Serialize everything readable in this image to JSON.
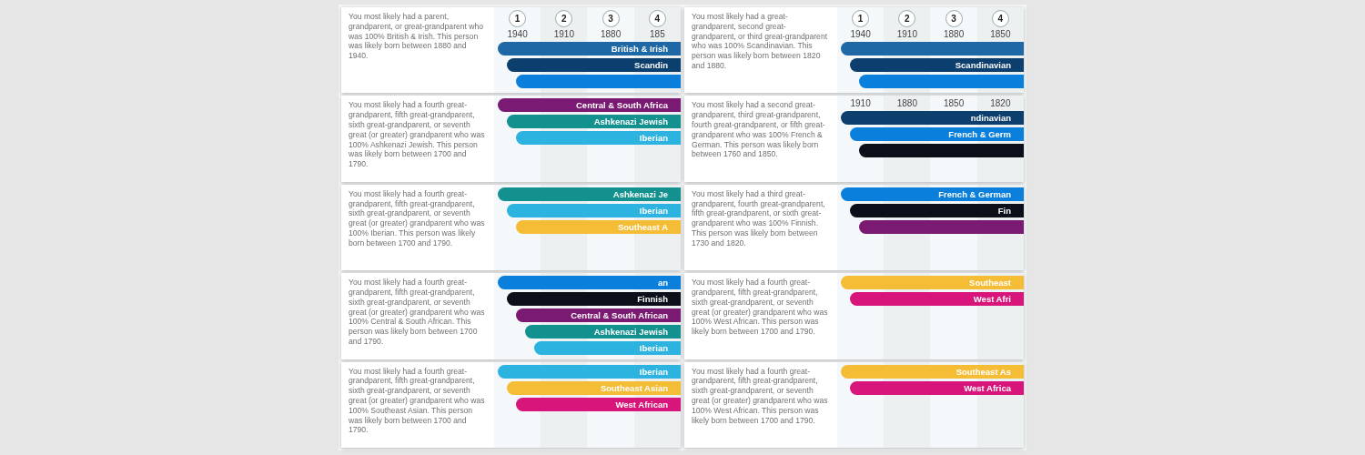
{
  "columns": [
    {
      "cards": [
        {
          "description": "You most likely had a parent, grandparent, or great-grandparent who was 100% British & Irish. This person was likely born between 1880 and 1940.",
          "steps": [
            {
              "number": "1",
              "year": "1940"
            },
            {
              "number": "2",
              "year": "1910"
            },
            {
              "number": "3",
              "year": "1880"
            },
            {
              "number": "4",
              "year": "185"
            }
          ],
          "bars": [
            {
              "label": "British & Irish",
              "color": "#1f68a6"
            },
            {
              "label": "Scandin",
              "color": "#0d3f6e"
            },
            {
              "color": "#0b7fdc"
            }
          ]
        },
        {
          "description": "You most likely had a fourth great-grandparent, fifth great-grandparent, sixth great-grandparent, or seventh great (or greater) grandparent who was 100% Ashkenazi Jewish. This person was likely born between 1700 and 1790.",
          "bars": [
            {
              "label": "Central & South Africa",
              "color": "#7a1a72"
            },
            {
              "label": "Ashkenazi Jewish",
              "color": "#12918f"
            },
            {
              "label": "Iberian",
              "color": "#2cb3e0"
            }
          ]
        },
        {
          "description": "You most likely had a fourth great-grandparent, fifth great-grandparent, sixth great-grandparent, or seventh great (or greater) grandparent who was 100% Iberian. This person was likely born between 1700 and 1790.",
          "bars": [
            {
              "label": "Ashkenazi Je",
              "color": "#12918f"
            },
            {
              "label": "Iberian",
              "color": "#2cb3e0"
            },
            {
              "label": "Southeast A",
              "color": "#f5bd35"
            }
          ]
        },
        {
          "description": "You most likely had a fourth great-grandparent, fifth great-grandparent, sixth great-grandparent, or seventh great (or greater) grandparent who was 100% Central & South African. This person was likely born between 1700 and 1790.",
          "bars": [
            {
              "label": "an",
              "color": "#0b7fdc"
            },
            {
              "label": "Finnish",
              "color": "#0a0f1a"
            },
            {
              "label": "Central & South African",
              "color": "#7a1a72"
            },
            {
              "label": "Ashkenazi Jewish",
              "color": "#12918f"
            },
            {
              "label": "Iberian",
              "color": "#2cb3e0"
            }
          ]
        },
        {
          "description": "You most likely had a fourth great-grandparent, fifth great-grandparent, sixth great-grandparent, or seventh great (or greater) grandparent who was 100% Southeast Asian. This person was likely born between 1700 and 1790.",
          "bars": [
            {
              "label": "Iberian",
              "color": "#2cb3e0"
            },
            {
              "label": "Southeast Asian",
              "color": "#f5bd35"
            },
            {
              "label": "West African",
              "color": "#d8157a"
            }
          ]
        }
      ]
    },
    {
      "cards": [
        {
          "description": "You most likely had a great-grandparent, second great-grandparent, or third great-grandparent who was 100% Scandinavian. This person was likely born between 1820 and 1880.",
          "steps": [
            {
              "number": "1",
              "year": "1940"
            },
            {
              "number": "2",
              "year": "1910"
            },
            {
              "number": "3",
              "year": "1880"
            },
            {
              "number": "4",
              "year": "1850"
            }
          ],
          "bars": [
            {
              "color": "#1f68a6"
            },
            {
              "label": "Scandinavian",
              "color": "#0d3f6e"
            },
            {
              "color": "#0b7fdc"
            }
          ]
        },
        {
          "description": "You most likely had a second great-grandparent, third great-grandparent, fourth great-grandparent, or fifth great-grandparent who was 100% French & German. This person was likely born between 1760 and 1850.",
          "years": [
            "1910",
            "1880",
            "1850",
            "1820"
          ],
          "bars": [
            {
              "label": "ndinavian",
              "color": "#0d3f6e"
            },
            {
              "label": "French & Germ",
              "color": "#0b7fdc"
            },
            {
              "color": "#0a0f1a"
            }
          ]
        },
        {
          "description": "You most likely had a third great-grandparent, fourth great-grandparent, fifth great-grandparent, or sixth great-grandparent who was 100% Finnish. This person was likely born between 1730 and 1820.",
          "bars": [
            {
              "label": "French & German",
              "color": "#0b7fdc"
            },
            {
              "label": "Fin",
              "color": "#0a0f1a"
            },
            {
              "color": "#7a1a72"
            }
          ]
        },
        {
          "description": "You most likely had a fourth great-grandparent, fifth great-grandparent, sixth great-grandparent, or seventh great (or greater) grandparent who was 100% West African. This person was likely born between 1700 and 1790.",
          "bars": [
            {
              "label": "Southeast",
              "color": "#f5bd35"
            },
            {
              "label": "West Afri",
              "color": "#d8157a"
            }
          ]
        },
        {
          "description": "You most likely had a fourth great-grandparent, fifth great-grandparent, sixth great-grandparent, or seventh great (or greater) grandparent who was 100% West African. This person was likely born between 1700 and 1790.",
          "bars": [
            {
              "label": "Southeast As",
              "color": "#f5bd35"
            },
            {
              "label": "West Africa",
              "color": "#d8157a"
            }
          ]
        }
      ]
    }
  ]
}
